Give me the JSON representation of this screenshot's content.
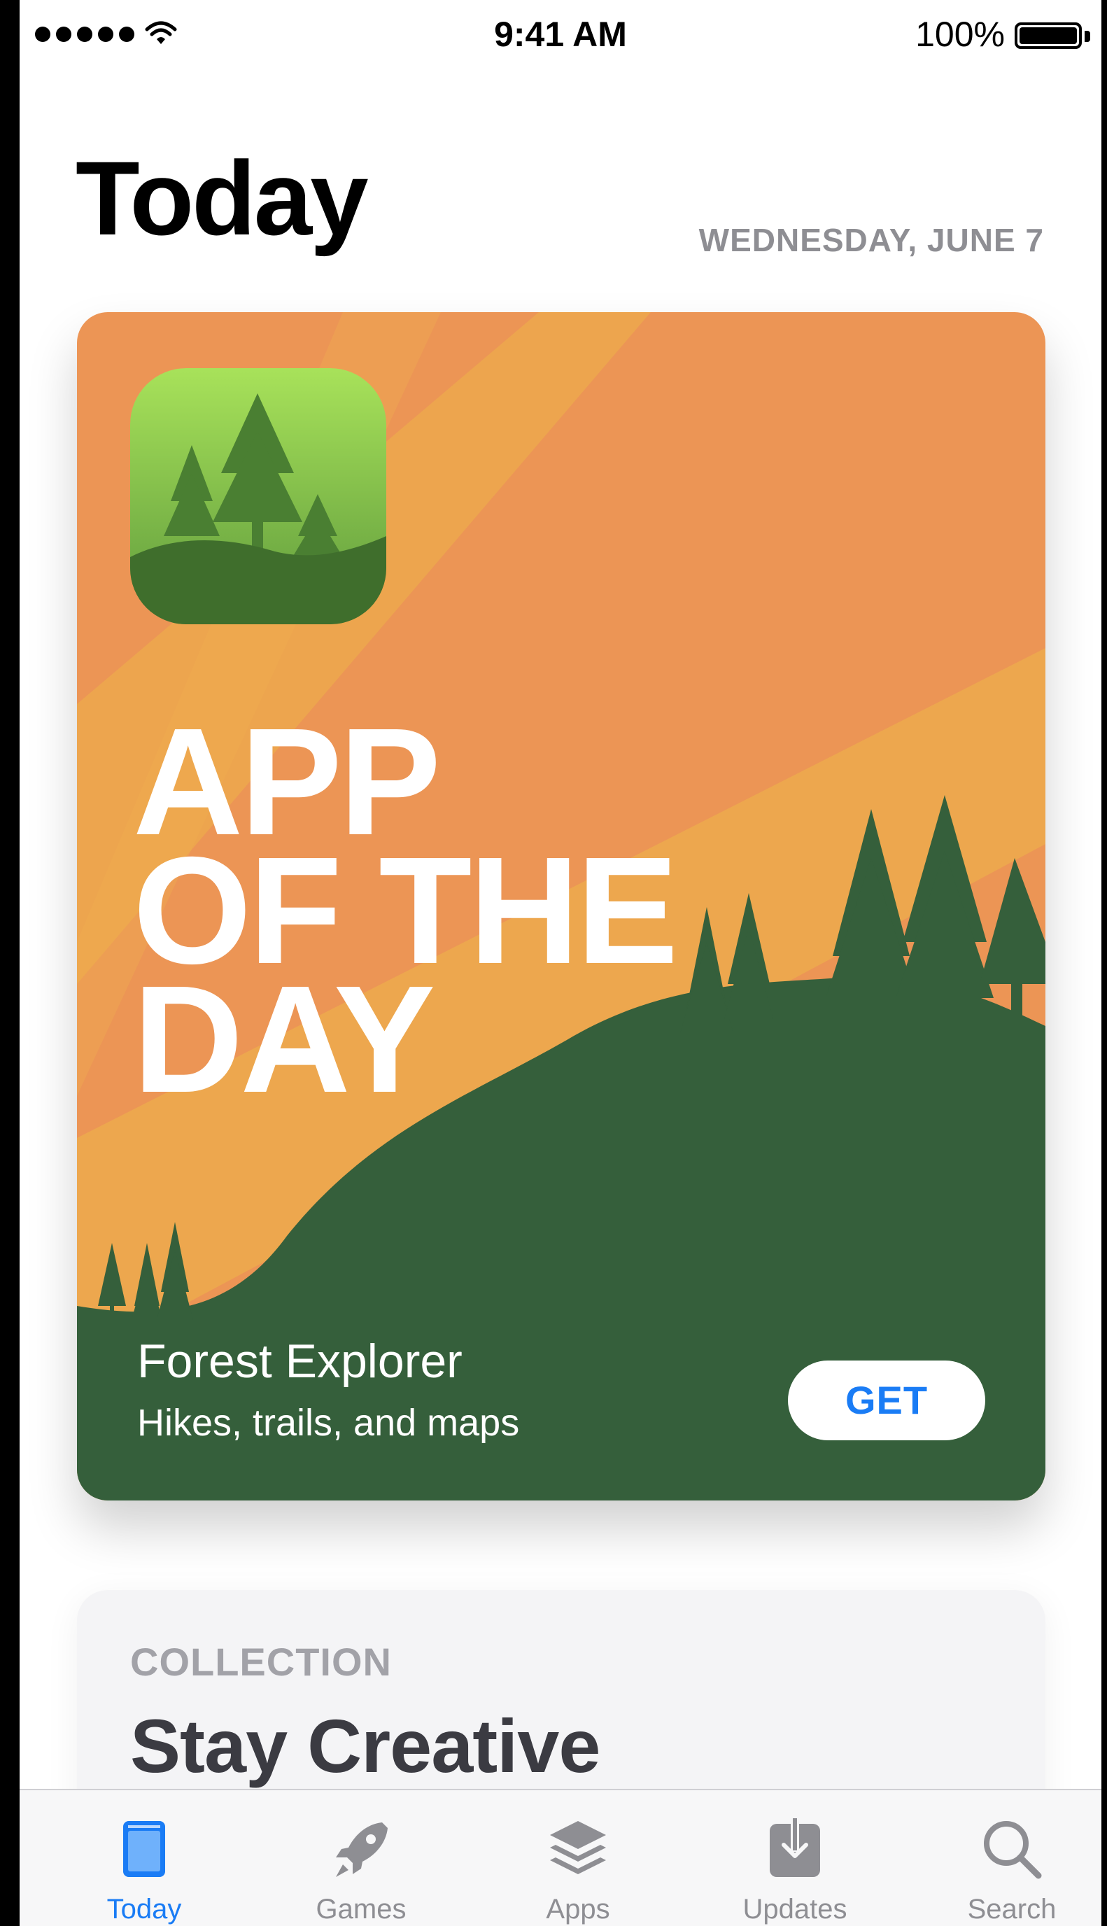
{
  "status_bar": {
    "time": "9:41 AM",
    "battery_percent": "100%",
    "signal_bars": 5,
    "icons": [
      "signal-dots-icon",
      "wifi-icon",
      "battery-icon"
    ]
  },
  "header": {
    "title": "Today",
    "date": "WEDNESDAY, JUNE 7"
  },
  "featured_card": {
    "headline_lines": [
      "APP",
      "OF THE",
      "DAY"
    ],
    "app_name": "Forest Explorer",
    "app_subtitle": "Hikes, trails, and maps",
    "get_label": "GET",
    "app_icon": "forest-app-icon",
    "colors": {
      "sky": "#ec9555",
      "sky_light": "#eda84e",
      "hill": "#355f3b",
      "icon_top": "#a8e25a",
      "icon_bottom": "#5e9a3c"
    }
  },
  "collection_card": {
    "kicker": "COLLECTION",
    "title": "Stay Creative"
  },
  "tab_bar": {
    "tabs": [
      {
        "label": "Today",
        "icon": "today-icon",
        "active": true
      },
      {
        "label": "Games",
        "icon": "rocket-icon",
        "active": false
      },
      {
        "label": "Apps",
        "icon": "layers-icon",
        "active": false
      },
      {
        "label": "Updates",
        "icon": "download-icon",
        "active": false
      },
      {
        "label": "Search",
        "icon": "search-icon",
        "active": false
      }
    ],
    "accent": "#1a7cf5",
    "inactive": "#8e8e93"
  }
}
